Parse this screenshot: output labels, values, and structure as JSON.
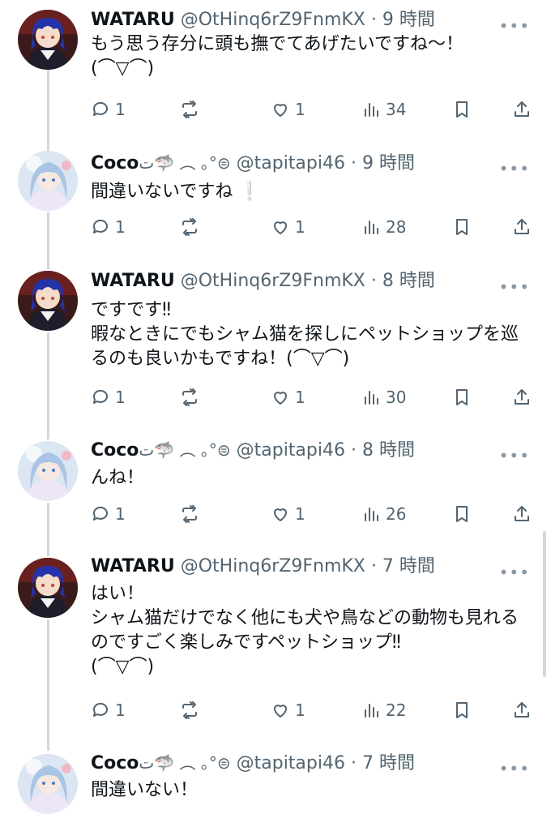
{
  "tweets": [
    {
      "author": "WATARU",
      "decoration": "",
      "handle": "@OtHinq6rZ9FnmKX",
      "sep": "·",
      "time": "9 時間",
      "text": "もう思う存分に頭も撫でてあげたいですね〜！\n(⌒▽⌒)",
      "replies": "1",
      "reposts": "",
      "likes": "1",
      "views": "34",
      "avatar": "wataru"
    },
    {
      "author": "Coco",
      "decoration": "ت🦈 ︵ ｡°⊜",
      "handle": "@tapitapi46",
      "sep": "·",
      "time": "9 時間",
      "text": "間違いないですね ❕",
      "replies": "1",
      "reposts": "",
      "likes": "1",
      "views": "28",
      "avatar": "coco"
    },
    {
      "author": "WATARU",
      "decoration": "",
      "handle": "@OtHinq6rZ9FnmKX",
      "sep": "·",
      "time": "8 時間",
      "text": "ですです‼︎\n暇なときにでもシャム猫を探しにペットショップを巡るのも良いかもですね！(⌒▽⌒)",
      "replies": "1",
      "reposts": "",
      "likes": "1",
      "views": "30",
      "avatar": "wataru"
    },
    {
      "author": "Coco",
      "decoration": "ت🦈 ︵ ｡°⊜",
      "handle": "@tapitapi46",
      "sep": "·",
      "time": "8 時間",
      "text": "んね！",
      "replies": "1",
      "reposts": "",
      "likes": "1",
      "views": "26",
      "avatar": "coco"
    },
    {
      "author": "WATARU",
      "decoration": "",
      "handle": "@OtHinq6rZ9FnmKX",
      "sep": "·",
      "time": "7 時間",
      "text": "はい！\nシャム猫だけでなく他にも犬や鳥などの動物も見れるのですごく楽しみですペットショップ‼︎\n(⌒▽⌒)",
      "replies": "1",
      "reposts": "",
      "likes": "1",
      "views": "22",
      "avatar": "wataru"
    },
    {
      "author": "Coco",
      "decoration": "ت🦈 ︵ ｡°⊜",
      "handle": "@tapitapi46",
      "sep": "·",
      "time": "7 時間",
      "text": "間違いない！",
      "replies": "",
      "reposts": "",
      "likes": "",
      "views": "",
      "avatar": "coco"
    }
  ],
  "icons": {
    "more": "more-dots-icon",
    "reply": "reply-icon",
    "repost": "repost-icon",
    "like": "heart-icon",
    "views": "views-bar-chart-icon",
    "bookmark": "bookmark-icon",
    "share": "share-icon"
  },
  "colors": {
    "text": "#0f1419",
    "muted": "#536471",
    "thread_line": "#cfd9de",
    "background": "#ffffff"
  }
}
